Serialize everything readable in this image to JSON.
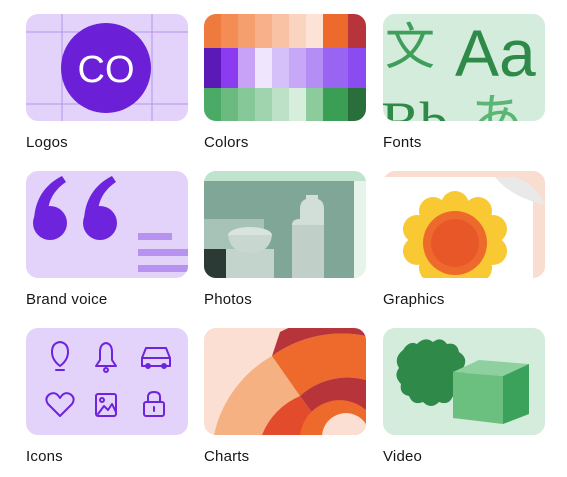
{
  "tiles": [
    {
      "id": "logos",
      "label": "Logos",
      "logo_text": "CO"
    },
    {
      "id": "colors",
      "label": "Colors"
    },
    {
      "id": "fonts",
      "label": "Fonts",
      "glyph_cjk": "文",
      "glyph_latin": "Aa",
      "glyph_bottom_latin": "Bb",
      "glyph_hiragana": "あ"
    },
    {
      "id": "brand-voice",
      "label": "Brand voice"
    },
    {
      "id": "photos",
      "label": "Photos"
    },
    {
      "id": "graphics",
      "label": "Graphics"
    },
    {
      "id": "icons",
      "label": "Icons"
    },
    {
      "id": "charts",
      "label": "Charts"
    },
    {
      "id": "video",
      "label": "Video"
    }
  ],
  "colors": {
    "lavender": "#e4d4fb",
    "purple": "#7d2ae8",
    "mint": "#d4ecdc",
    "green": "#3aa25a",
    "peach": "#f9ddd0",
    "orange": "#f26a2e",
    "red": "#b7353a"
  }
}
